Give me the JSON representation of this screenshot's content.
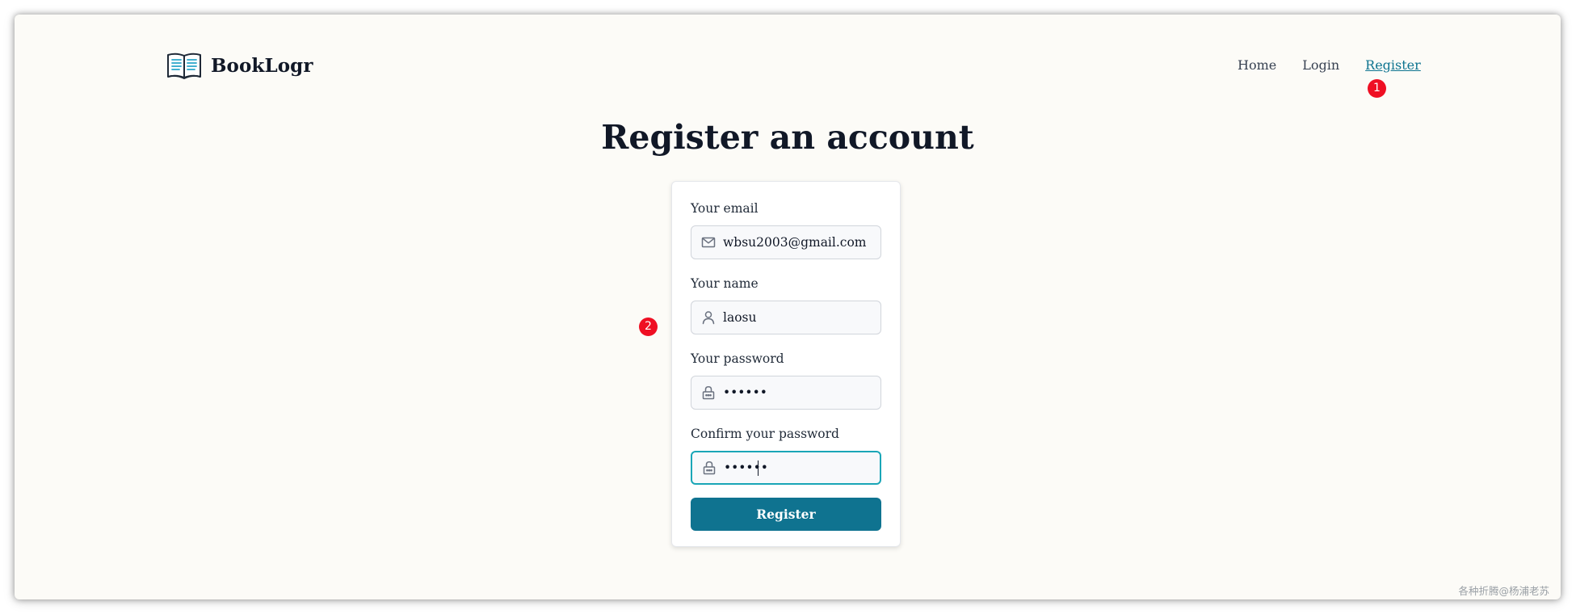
{
  "brand": {
    "name": "BookLogr",
    "icon": "open-book-icon"
  },
  "nav": {
    "items": [
      {
        "label": "Home"
      },
      {
        "label": "Login"
      },
      {
        "label": "Register",
        "active": true
      }
    ]
  },
  "annotations": {
    "badge_1": "1",
    "badge_2": "2"
  },
  "page": {
    "title": "Register an account"
  },
  "form": {
    "fields": [
      {
        "label": "Your email",
        "value": "wbsu2003@gmail.com",
        "type": "email",
        "icon": "mail-icon"
      },
      {
        "label": "Your name",
        "value": "laosu",
        "type": "text",
        "icon": "user-icon"
      },
      {
        "label": "Your password",
        "value": "••••••",
        "type": "password",
        "icon": "lock-icon"
      },
      {
        "label": "Confirm your password",
        "value": "••••••",
        "type": "password",
        "icon": "lock-icon",
        "focused": true
      }
    ],
    "submit_label": "Register"
  },
  "watermark": "各种折腾@杨浦老苏",
  "colors": {
    "background": "#fcfbf7",
    "accent": "#0f7390",
    "focus_ring": "#1aa6b7",
    "link_active": "#0e7490",
    "badge": "#ef0f23"
  }
}
